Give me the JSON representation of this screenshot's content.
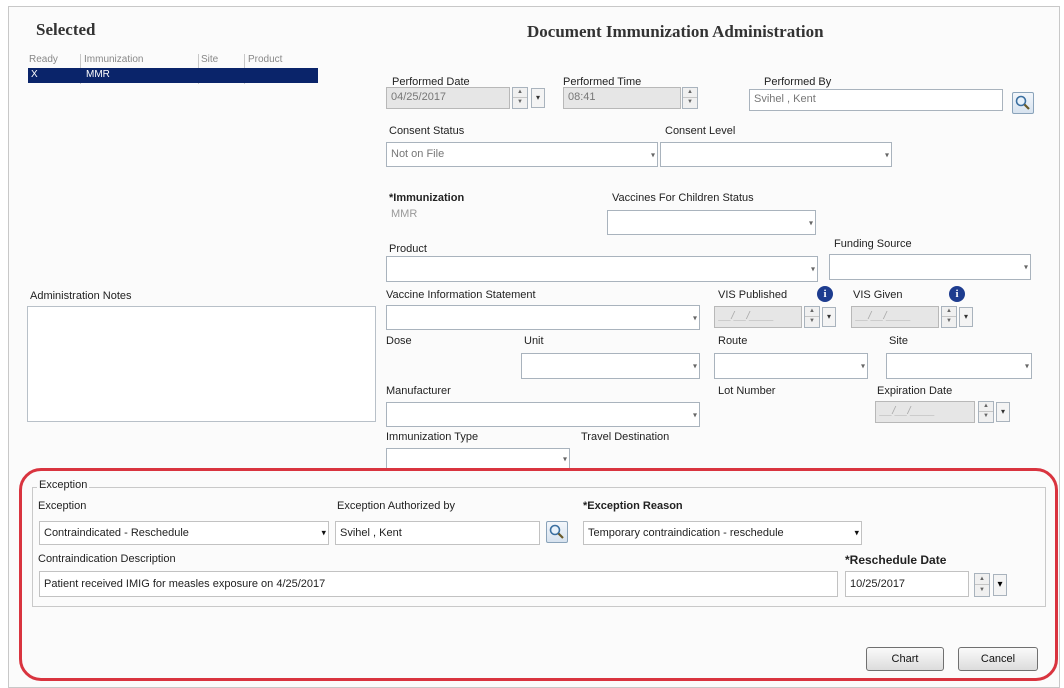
{
  "selected": {
    "title": "Selected",
    "columns": [
      "Ready",
      "Immunization",
      "Site",
      "Product"
    ],
    "row": {
      "ready": "X",
      "immunization": "MMR",
      "site": "",
      "product": ""
    }
  },
  "form_title": "Document Immunization Administration",
  "performed_date": {
    "label": "Performed Date",
    "value": "04/25/2017"
  },
  "performed_time": {
    "label": "Performed Time",
    "value": "08:41"
  },
  "performed_by": {
    "label": "Performed By",
    "value": "Svihel , Kent"
  },
  "consent_status": {
    "label": "Consent Status",
    "value": "Not on File"
  },
  "consent_level": {
    "label": "Consent Level",
    "value": ""
  },
  "immunization": {
    "required_mark": "*",
    "label": "Immunization",
    "value": "MMR"
  },
  "vfc_status": {
    "label": "Vaccines For Children Status",
    "value": ""
  },
  "product": {
    "label": "Product",
    "value": ""
  },
  "funding_source": {
    "label": "Funding Source",
    "value": ""
  },
  "admin_notes": {
    "label": "Administration Notes",
    "value": ""
  },
  "vis": {
    "label": "Vaccine Information Statement",
    "value": ""
  },
  "vis_published": {
    "label": "VIS Published",
    "placeholder": "__/__/____"
  },
  "vis_given": {
    "label": "VIS Given",
    "placeholder": "__/__/____"
  },
  "dose": {
    "label": "Dose"
  },
  "unit": {
    "label": "Unit",
    "value": ""
  },
  "route": {
    "label": "Route",
    "value": ""
  },
  "site": {
    "label": "Site",
    "value": ""
  },
  "manufacturer": {
    "label": "Manufacturer",
    "value": ""
  },
  "lot_number": {
    "label": "Lot Number"
  },
  "expiration_date": {
    "label": "Expiration Date",
    "placeholder": "__/__/____"
  },
  "immunization_type": {
    "label": "Immunization Type",
    "value": ""
  },
  "travel_destination": {
    "label": "Travel Destination"
  },
  "exception_group": {
    "title": "Exception",
    "exception": {
      "label": "Exception",
      "value": "Contraindicated - Reschedule"
    },
    "authorized_by": {
      "label": "Exception Authorized by",
      "value": "Svihel , Kent"
    },
    "reason": {
      "label": "*Exception Reason",
      "value": "Temporary contraindication - reschedule"
    },
    "contra_desc": {
      "label": "Contraindication Description",
      "value": "Patient received IMIG for measles exposure on 4/25/2017"
    },
    "reschedule_date": {
      "label": "*Reschedule Date",
      "value": "10/25/2017"
    }
  },
  "buttons": {
    "chart": "Chart",
    "cancel": "Cancel"
  },
  "info_glyph": "i",
  "dropdown_arrow": "▾",
  "highlight_color": "#d9343f",
  "selection_color": "#0a246a"
}
